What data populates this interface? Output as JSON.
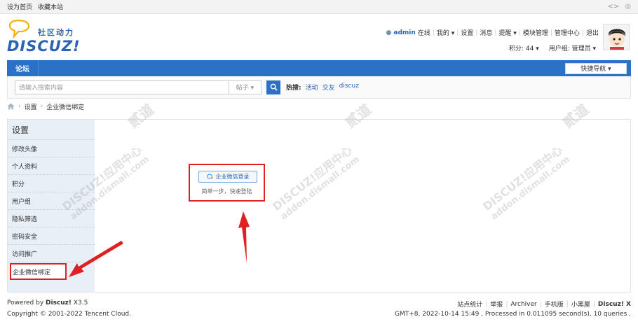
{
  "topbar": {
    "links": [
      "设为首页",
      "收藏本站"
    ]
  },
  "logo": {
    "brand": "DISCUZ!",
    "slogan": "社区动力"
  },
  "user": {
    "name": "admin",
    "status": "在线",
    "menu": [
      "我的 ▾",
      "设置",
      "消息",
      "提醒 ▾",
      "模块管理",
      "管理中心",
      "退出"
    ],
    "points": "积分: 44 ▾",
    "group": "用户组: 管理员 ▾"
  },
  "nav": {
    "forum": "论坛",
    "quick": "快捷导航 ▾"
  },
  "search": {
    "placeholder": "请输入搜索内容",
    "type": "帖子 ▾",
    "hot_label": "热搜:",
    "hot_tags": [
      "活动",
      "交友",
      "discuz"
    ]
  },
  "breadcrumb": {
    "items": [
      "设置",
      "企业微信绑定"
    ]
  },
  "sidebar": {
    "title": "设置",
    "items": [
      "修改头像",
      "个人资料",
      "积分",
      "用户组",
      "隐私筛选",
      "密码安全",
      "访问推广",
      "企业微信绑定"
    ]
  },
  "login": {
    "button": "企业微信登录",
    "hint": "简单一步，快速登陆"
  },
  "watermark": {
    "line1": "DISCUZ!应用中心",
    "line2": "addon.dismall.com",
    "tag": "贰道"
  },
  "footer": {
    "powered_prefix": "Powered by ",
    "powered_brand": "Discuz!",
    "powered_version": " X3.5",
    "copyright": "Copyright © 2001-2022 Tencent Cloud.",
    "links": [
      "站点统计",
      "举报",
      "Archiver",
      "手机版",
      "小黑屋",
      "Discuz! X"
    ],
    "timing": "GMT+8, 2022-10-14 15:49 , Processed in 0.011095 second(s), 10 queries ."
  },
  "colors": {
    "brand": "#2b72c6",
    "annotation": "#e02020"
  }
}
